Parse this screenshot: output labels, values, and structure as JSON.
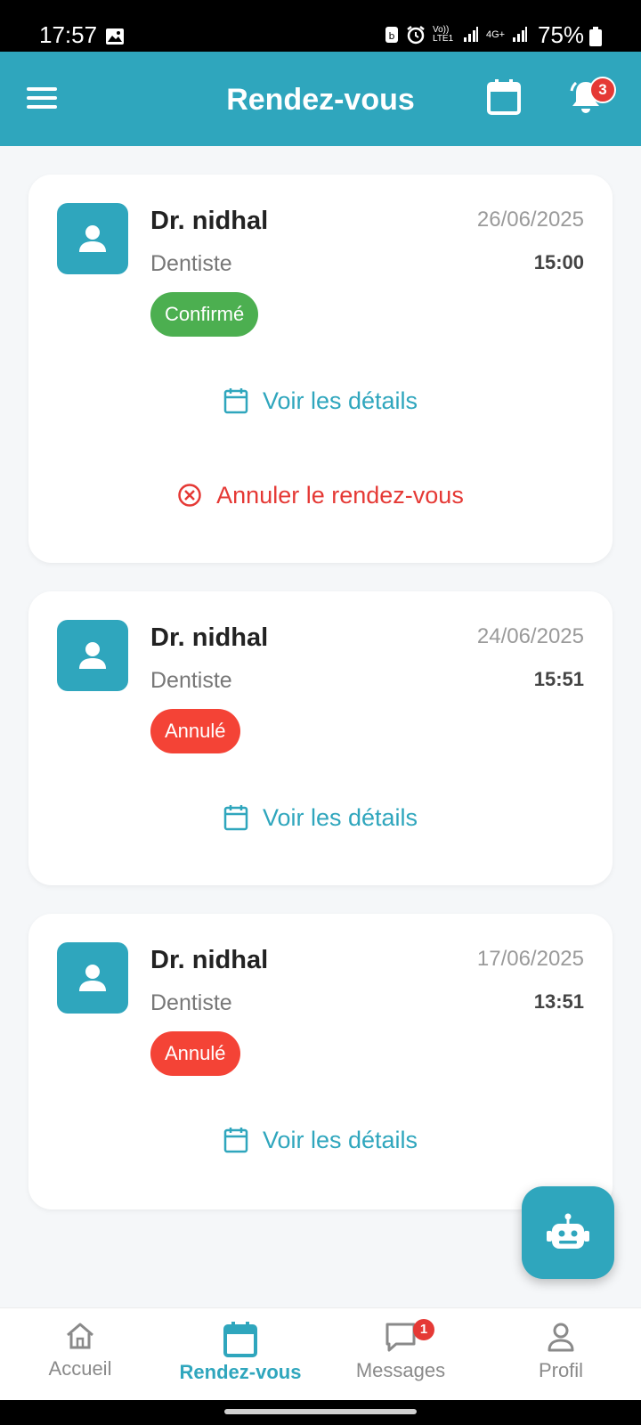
{
  "status_bar": {
    "time": "17:57",
    "battery": "75%",
    "network_1": "Vo)) LTE1",
    "network_2": "4G+"
  },
  "header": {
    "title": "Rendez-vous",
    "notification_count": "3",
    "icons": [
      "menu-icon",
      "calendar-icon",
      "bell-icon"
    ]
  },
  "appointments": [
    {
      "doctor": "Dr. nidhal",
      "specialty": "Dentiste",
      "date": "26/06/2025",
      "time": "15:00",
      "status": "Confirmé",
      "details_label": "Voir les détails",
      "cancel_label": "Annuler le rendez-vous"
    },
    {
      "doctor": "Dr. nidhal",
      "specialty": "Dentiste",
      "date": "24/06/2025",
      "time": "15:51",
      "status": "Annulé",
      "details_label": "Voir les détails"
    },
    {
      "doctor": "Dr. nidhal",
      "specialty": "Dentiste",
      "date": "17/06/2025",
      "time": "13:51",
      "status": "Annulé",
      "details_label": "Voir les détails"
    }
  ],
  "bottom_nav": {
    "items": [
      {
        "label": "Accueil",
        "icon": "home-icon",
        "active": false
      },
      {
        "label": "Rendez-vous",
        "icon": "calendar-icon",
        "active": true
      },
      {
        "label": "Messages",
        "icon": "chat-icon",
        "active": false,
        "badge": "1"
      },
      {
        "label": "Profil",
        "icon": "person-icon",
        "active": false
      }
    ]
  },
  "colors": {
    "primary": "#2fa6bd",
    "confirmed": "#4caf50",
    "cancelled": "#f44336",
    "danger_text": "#e53935"
  }
}
